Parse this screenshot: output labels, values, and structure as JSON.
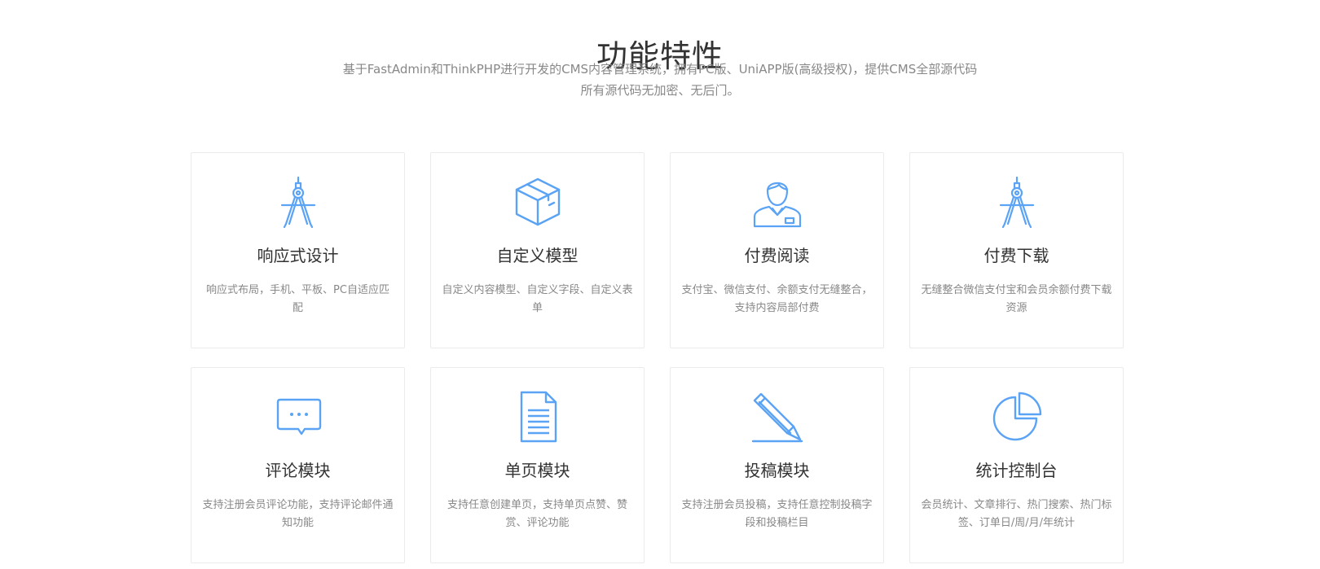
{
  "header": {
    "title": "功能特性",
    "desc_line1": "基于FastAdmin和ThinkPHP进行开发的CMS内容管理系统，拥有PC版、UniAPP版(高级授权)，提供CMS全部源代码",
    "desc_line2": "所有源代码无加密、无后门。"
  },
  "colors": {
    "icon": "#5ba3f5",
    "title": "#333333",
    "text": "#888888",
    "border": "#ebebeb"
  },
  "features": [
    {
      "icon": "compass-icon",
      "title": "响应式设计",
      "desc": "响应式布局，手机、平板、PC自适应匹配"
    },
    {
      "icon": "box-icon",
      "title": "自定义模型",
      "desc": "自定义内容模型、自定义字段、自定义表单"
    },
    {
      "icon": "user-icon",
      "title": "付费阅读",
      "desc": "支付宝、微信支付、余额支付无缝整合，支持内容局部付费"
    },
    {
      "icon": "compass-icon",
      "title": "付费下载",
      "desc": "无缝整合微信支付宝和会员余额付费下载资源"
    },
    {
      "icon": "chat-icon",
      "title": "评论模块",
      "desc": "支持注册会员评论功能，支持评论邮件通知功能"
    },
    {
      "icon": "document-icon",
      "title": "单页模块",
      "desc": "支持任意创建单页，支持单页点赞、赞赏、评论功能"
    },
    {
      "icon": "pencil-icon",
      "title": "投稿模块",
      "desc": "支持注册会员投稿，支持任意控制投稿字段和投稿栏目"
    },
    {
      "icon": "pie-chart-icon",
      "title": "统计控制台",
      "desc": "会员统计、文章排行、热门搜索、热门标签、订单日/周/月/年统计"
    }
  ]
}
